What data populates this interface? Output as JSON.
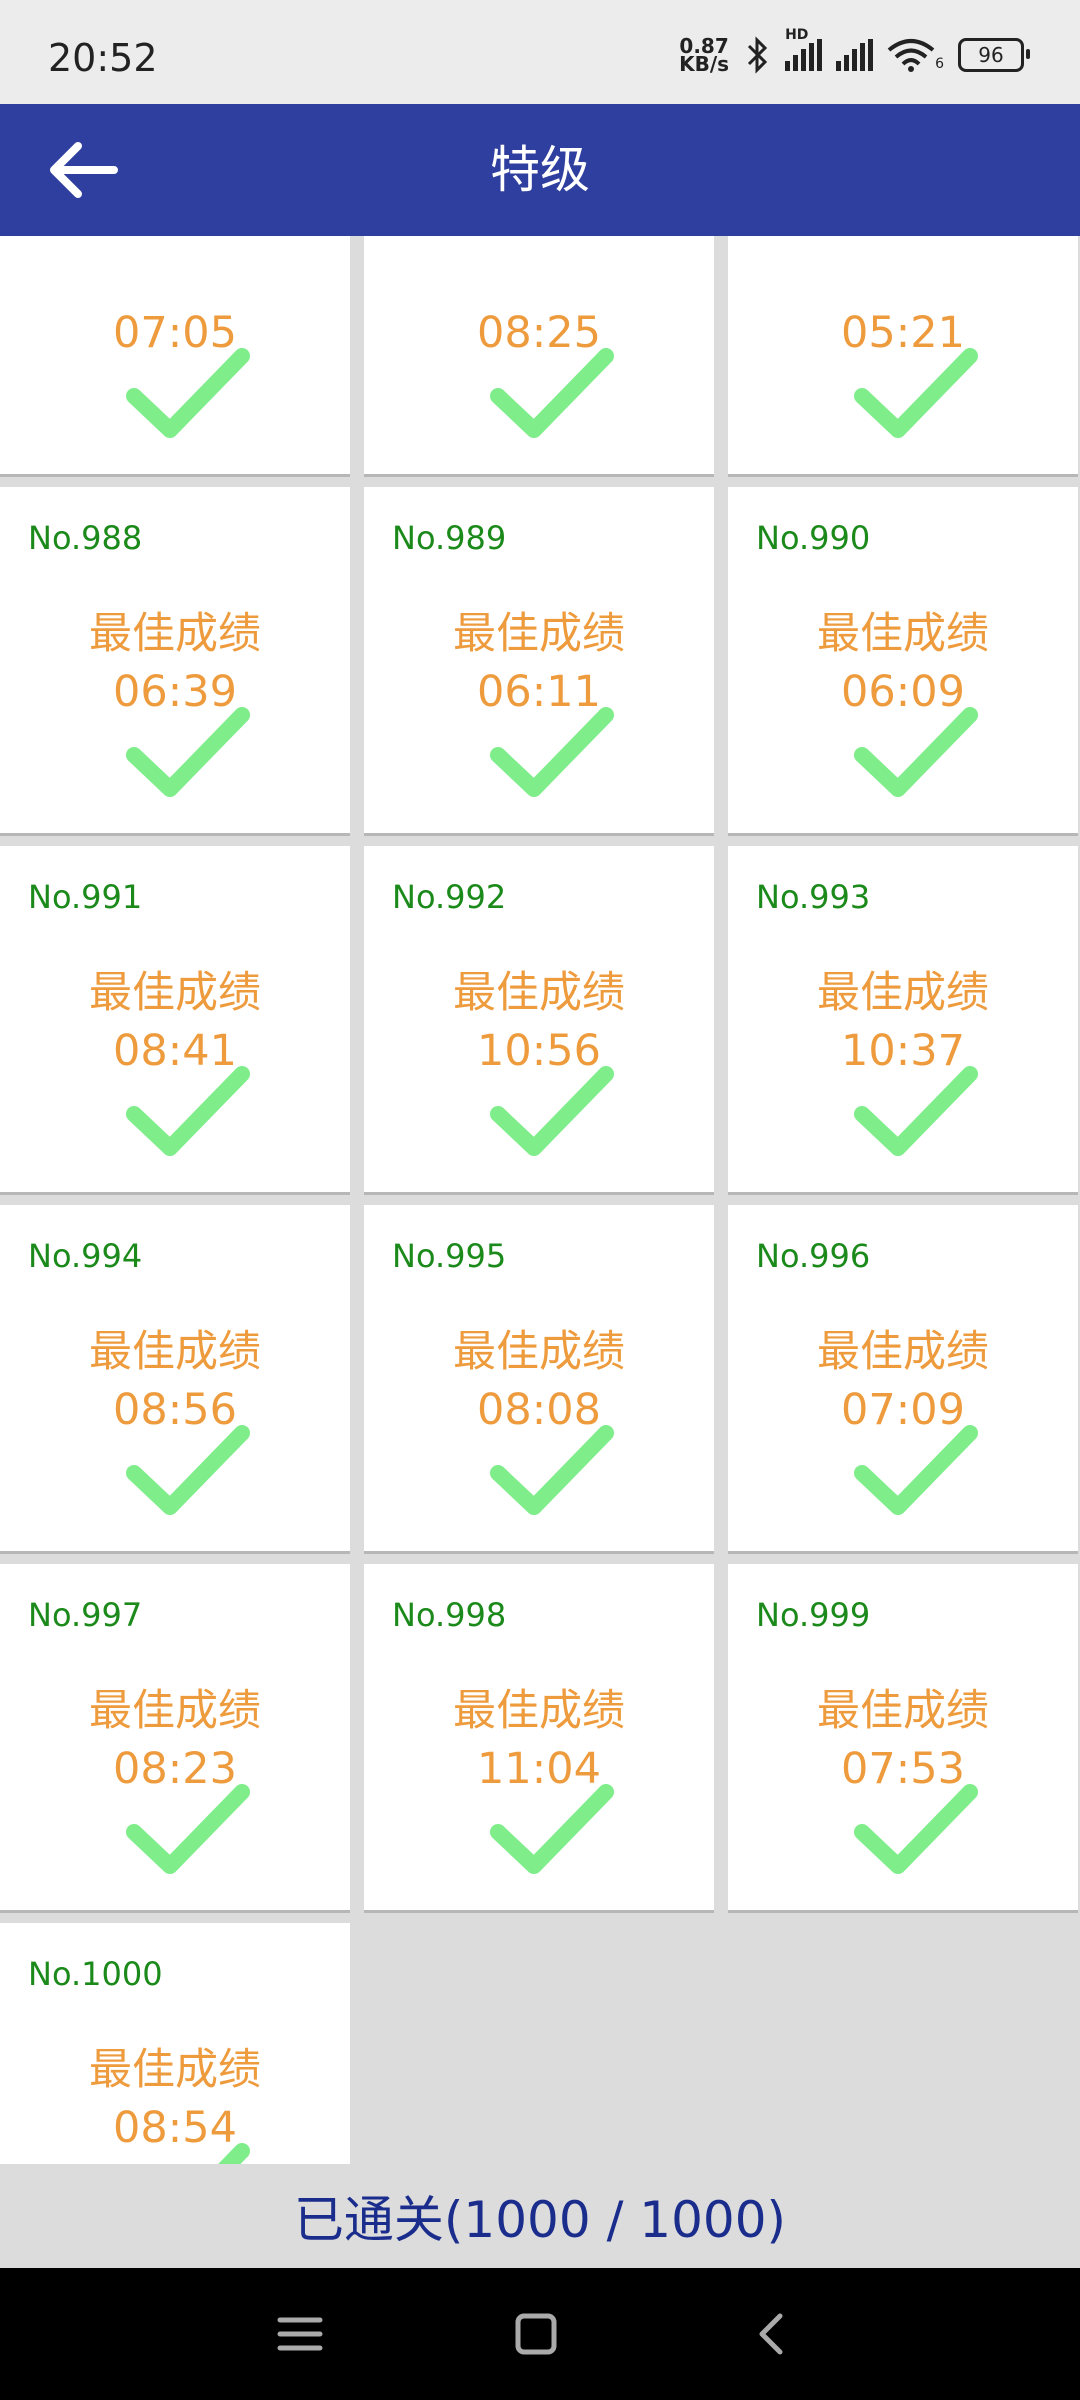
{
  "status_bar": {
    "time": "20:52",
    "net_speed_value": "0.87",
    "net_speed_unit": "KB/s",
    "hd_label": "HD",
    "wifi_label": "6",
    "battery": "96"
  },
  "app_bar": {
    "title": "特级",
    "back_icon": "arrow-left-icon"
  },
  "partial_row": {
    "times": [
      "07:05",
      "08:25",
      "05:21"
    ]
  },
  "levels": [
    {
      "no": "No.988",
      "label": "最佳成绩",
      "time": "06:39"
    },
    {
      "no": "No.989",
      "label": "最佳成绩",
      "time": "06:11"
    },
    {
      "no": "No.990",
      "label": "最佳成绩",
      "time": "06:09"
    },
    {
      "no": "No.991",
      "label": "最佳成绩",
      "time": "08:41"
    },
    {
      "no": "No.992",
      "label": "最佳成绩",
      "time": "10:56"
    },
    {
      "no": "No.993",
      "label": "最佳成绩",
      "time": "10:37"
    },
    {
      "no": "No.994",
      "label": "最佳成绩",
      "time": "08:56"
    },
    {
      "no": "No.995",
      "label": "最佳成绩",
      "time": "08:08"
    },
    {
      "no": "No.996",
      "label": "最佳成绩",
      "time": "07:09"
    },
    {
      "no": "No.997",
      "label": "最佳成绩",
      "time": "08:23"
    },
    {
      "no": "No.998",
      "label": "最佳成绩",
      "time": "11:04"
    },
    {
      "no": "No.999",
      "label": "最佳成绩",
      "time": "07:53"
    },
    {
      "no": "No.1000",
      "label": "最佳成绩",
      "time": "08:54"
    }
  ],
  "footer": {
    "progress_text": "已通关(1000 / 1000)"
  },
  "colors": {
    "app_bar": "#2f3f9f",
    "level_number": "#1b8a1b",
    "best_score": "#ee9b3e",
    "checkmark": "#7eed8a",
    "footer_text": "#1a2d8c"
  },
  "nav_bar": {
    "icons": [
      "menu-icon",
      "home-icon",
      "back-icon"
    ]
  }
}
